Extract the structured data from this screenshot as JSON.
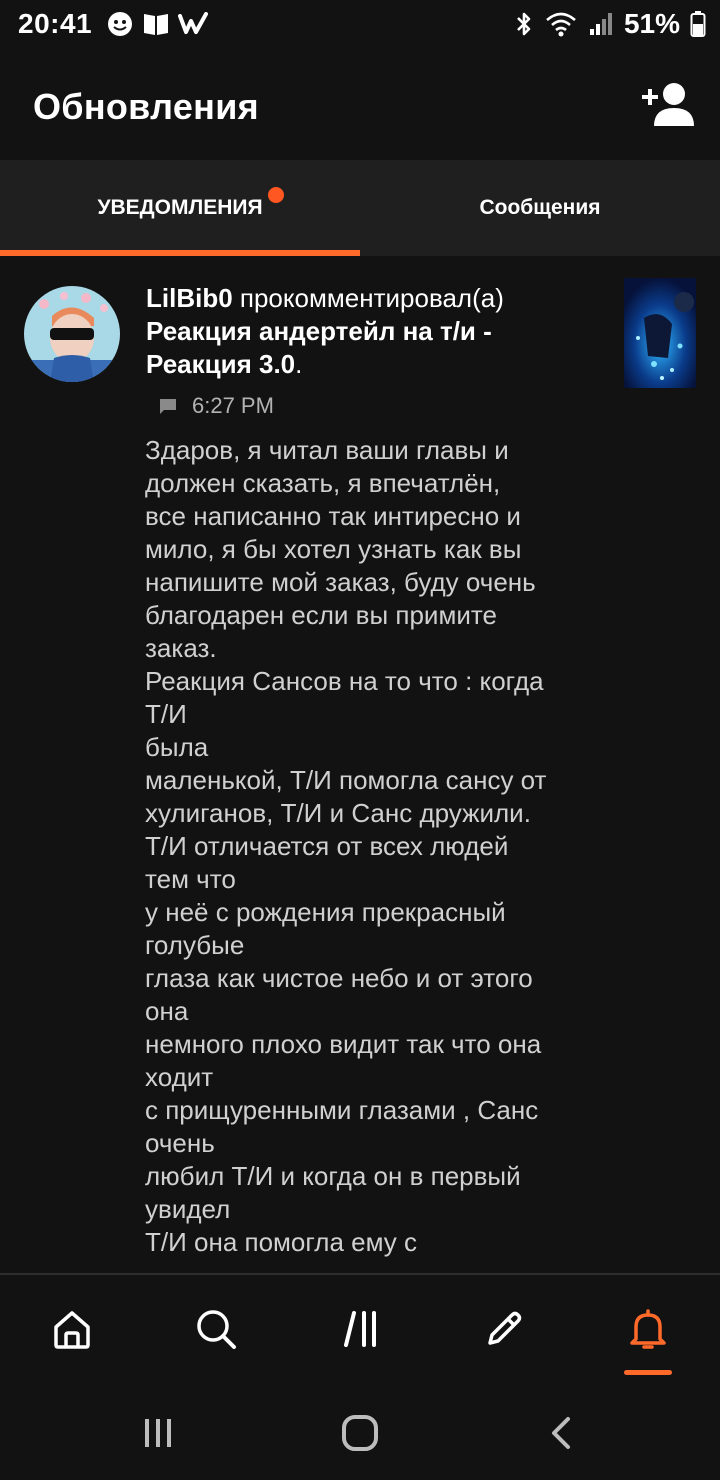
{
  "status_bar": {
    "time": "20:41",
    "battery_percent": "51%",
    "icons": [
      "face-icon",
      "book-icon",
      "w-app-icon",
      "bluetooth-icon",
      "wifi-icon",
      "signal-icon",
      "battery-icon"
    ]
  },
  "header": {
    "title": "Обновления",
    "action_icon": "add-user-icon"
  },
  "tabs": [
    {
      "label": "УВЕДОМЛЕНИЯ",
      "active": true,
      "has_badge": true
    },
    {
      "label": "Сообщения",
      "active": false,
      "has_badge": false
    }
  ],
  "notification": {
    "username": "LilBib0",
    "action": " прокомментировал(а)",
    "story_title": "Реакция андертейл на т/и - Реакция 3.0",
    "title_suffix": ".",
    "time": "6:27 PM",
    "comment": "Здаров, я читал ваши главы и\nдолжен сказать, я впечатлён,\nвсе написанно так интиресно и\nмило, я бы хотел узнать как вы\nнапишите мой заказ, буду очень\nблагодарен если вы примите\nзаказ.\nРеакция Сансов на то что : когда\nТ/И\nбыла\nмаленькой, Т/И помогла сансу от\nхулиганов, Т/И и Санс дружили.\nТ/И отличается от всех людей\nтем что\nу неё с рождения прекрасный\nголубые\nглаза как чистое небо и от этого\nона\nнемного плохо видит так что она\nходит\nс прищуренными глазами , Санс\nочень\nлюбил Т/И и когда он в первый\nувидел\nТ/И она помогла ему с"
  },
  "bottom_nav": [
    {
      "name": "home-icon",
      "active": false
    },
    {
      "name": "search-icon",
      "active": false
    },
    {
      "name": "library-icon",
      "active": false
    },
    {
      "name": "write-icon",
      "active": false
    },
    {
      "name": "bell-icon",
      "active": true
    }
  ],
  "colors": {
    "accent": "#ff6a2b",
    "badge": "#ff5722",
    "background": "#121212",
    "tab_background": "#1f1f1f",
    "comment_text": "#d0d0d0",
    "meta_text": "#b3b3b3"
  }
}
